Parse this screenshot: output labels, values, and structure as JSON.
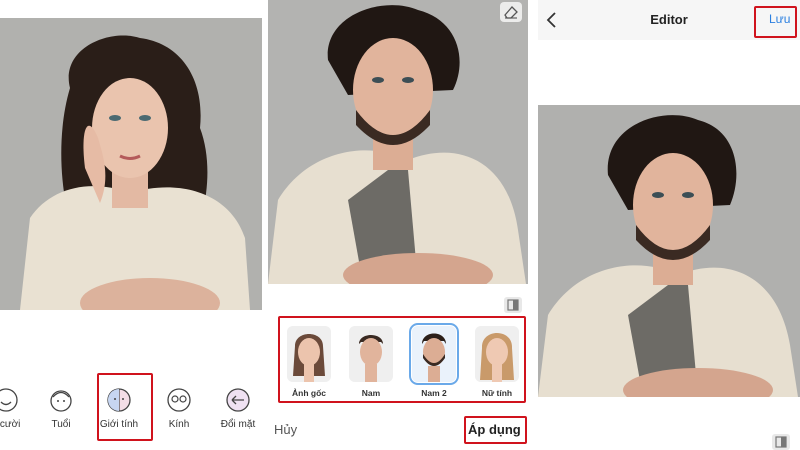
{
  "panel1": {
    "tools": [
      {
        "label": "n cười",
        "icon": "smile-face-icon"
      },
      {
        "label": "Tuổi",
        "icon": "age-face-icon"
      },
      {
        "label": "Giới tính",
        "icon": "gender-face-icon"
      },
      {
        "label": "Kính",
        "icon": "glasses-face-icon"
      },
      {
        "label": "Đổi mặt",
        "icon": "face-swap-icon"
      }
    ]
  },
  "panel2": {
    "thumbnails": [
      {
        "label": "Ảnh gốc"
      },
      {
        "label": "Nam"
      },
      {
        "label": "Nam 2",
        "selected": true
      },
      {
        "label": "Nữ tính"
      }
    ],
    "cancel_label": "Hủy",
    "apply_label": "Áp dụng"
  },
  "panel3": {
    "title": "Editor",
    "save_label": "Lưu"
  },
  "colors": {
    "highlight": "#d0131d",
    "accent": "#2a7fe0",
    "selected_thumb": "#6aa9e9",
    "background": "#ffffff"
  }
}
